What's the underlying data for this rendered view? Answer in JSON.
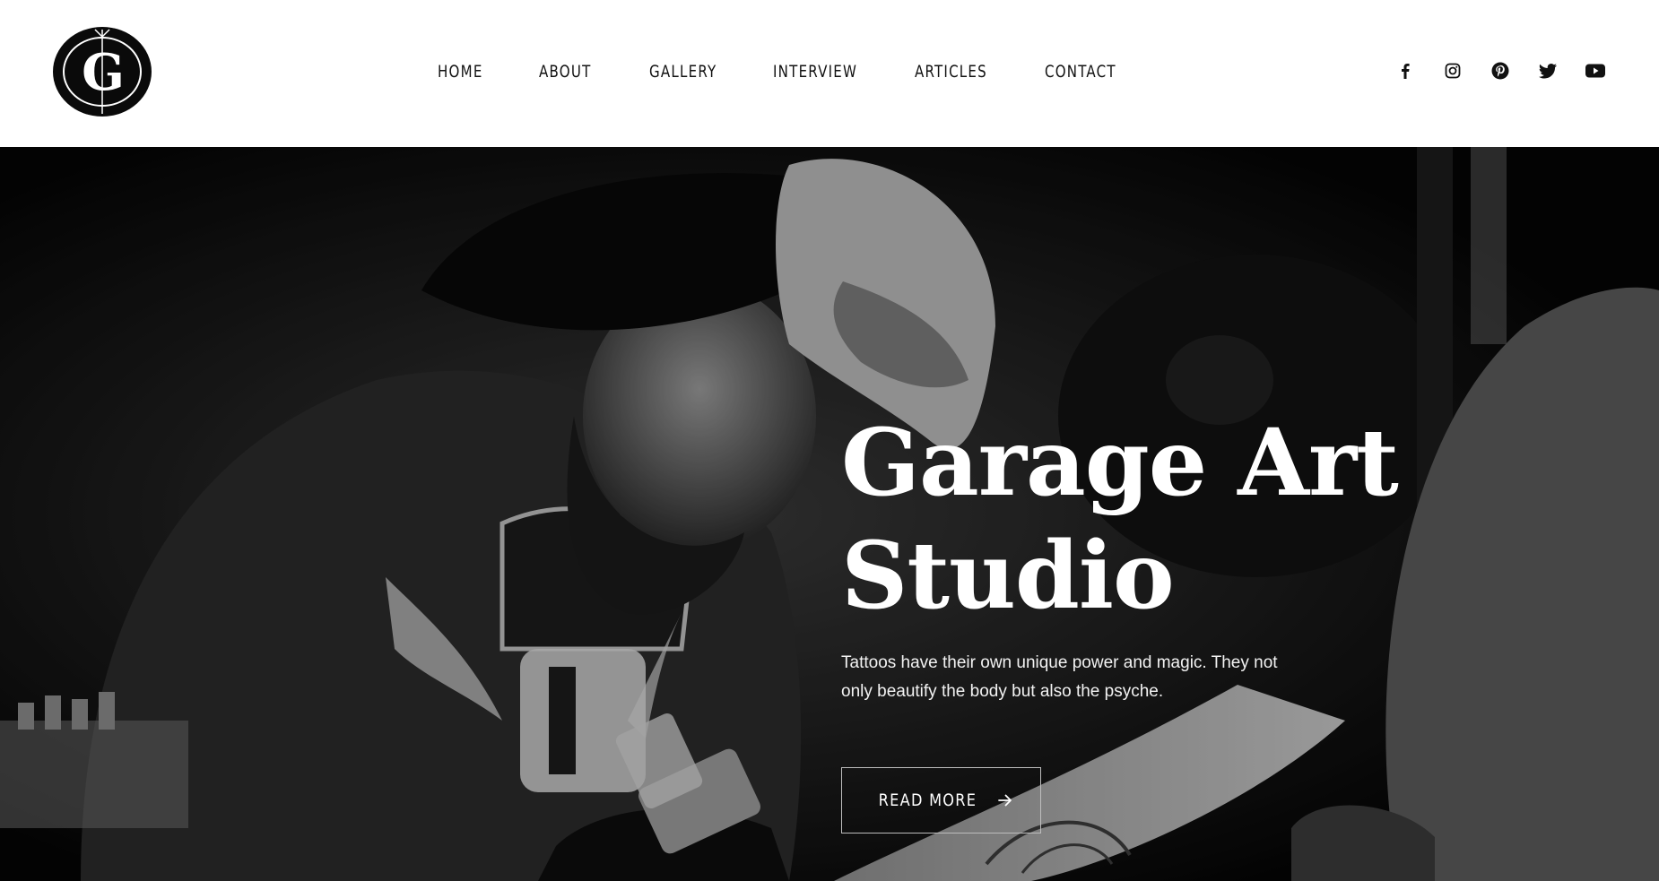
{
  "header": {
    "logo_monogram": "G",
    "nav": [
      {
        "label": "HOME"
      },
      {
        "label": "ABOUT"
      },
      {
        "label": "GALLERY"
      },
      {
        "label": "INTERVIEW"
      },
      {
        "label": "ARTICLES"
      },
      {
        "label": "CONTACT"
      }
    ],
    "social": [
      {
        "icon": "facebook-icon"
      },
      {
        "icon": "instagram-icon"
      },
      {
        "icon": "pinterest-icon"
      },
      {
        "icon": "twitter-icon"
      },
      {
        "icon": "youtube-icon"
      }
    ]
  },
  "hero": {
    "title_line1": "Garage Art",
    "title_line2": "Studio",
    "text_line1": "Tattoos have their own unique power and magic. They not",
    "text_line2": "only beautify the body but also the psyche.",
    "button_label": "READ MORE",
    "button_icon": "arrow-right-icon"
  },
  "colors": {
    "header_bg": "#ffffff",
    "nav_text": "#111111",
    "hero_bg": "#050505",
    "hero_text": "#ffffff"
  }
}
